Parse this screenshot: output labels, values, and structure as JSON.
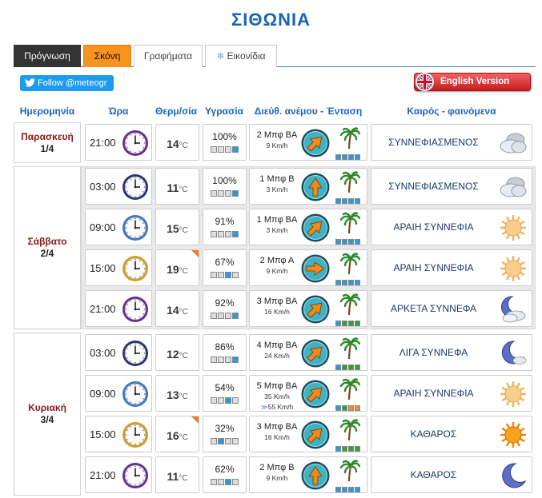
{
  "title": "ΣΙΘΩΝΙΑ",
  "tabs": [
    {
      "label": "Πρόγνωση"
    },
    {
      "label": "Σκόνη"
    },
    {
      "label": "Γραφήματα"
    },
    {
      "label": "Εικονίδια"
    }
  ],
  "twitter": {
    "label": "Follow @meteogr"
  },
  "english": {
    "label": "English Version"
  },
  "headers": {
    "date": "Ημερομηνία",
    "time": "Ώρα",
    "temp": "Θερμ/σία",
    "hum": "Υγρασία",
    "wind": "Διεύθ. ανέμου - Ένταση",
    "weather": "Καιρός - φαινόμενα"
  },
  "temp_unit": "°C",
  "wind_unit": "Km/h",
  "days": [
    {
      "name": "Παρασκευή",
      "date": "1/4"
    },
    {
      "name": "Σάββατο",
      "date": "2/4"
    },
    {
      "name": "Κυριακή",
      "date": "3/4"
    }
  ],
  "rows": [
    {
      "time": "21:00",
      "clock": "purple",
      "temp": "14",
      "hum": "100%",
      "hbars": [
        0,
        0,
        0,
        1
      ],
      "wind": "2 Μπφ ΒΑ",
      "speed": "9",
      "dir": 225,
      "wbars": "bbbb",
      "weather": "ΣΥΝΝΕΦΙΑΣΜΕΝΟΣ",
      "icon": "cloudy"
    },
    {
      "time": "03:00",
      "clock": "navy",
      "temp": "11",
      "hum": "100%",
      "hbars": [
        0,
        0,
        0,
        1
      ],
      "wind": "1 Μπφ Β",
      "speed": "3",
      "dir": 180,
      "wbars": "bbbb",
      "weather": "ΣΥΝΝΕΦΙΑΣΜΕΝΟΣ",
      "icon": "cloudy"
    },
    {
      "time": "09:00",
      "clock": "blue",
      "temp": "15",
      "hum": "91%",
      "hbars": [
        0,
        0,
        0,
        1
      ],
      "wind": "1 Μπφ ΒΑ",
      "speed": "3",
      "dir": 225,
      "wbars": "bbbb",
      "weather": "ΑΡΑΙΗ ΣΥΝΝΕΦΙΑ",
      "icon": "sunpale"
    },
    {
      "time": "15:00",
      "clock": "gold",
      "temp": "19",
      "tri": true,
      "hum": "67%",
      "hbars": [
        0,
        0,
        1,
        0
      ],
      "wind": "2 Μπφ Α",
      "speed": "9",
      "dir": 270,
      "wbars": "bbbb",
      "weather": "ΑΡΑΙΗ ΣΥΝΝΕΦΙΑ",
      "icon": "sunpale"
    },
    {
      "time": "21:00",
      "clock": "purple",
      "temp": "14",
      "hum": "92%",
      "hbars": [
        0,
        0,
        0,
        1
      ],
      "wind": "3 Μπφ ΒΑ",
      "speed": "16",
      "dir": 225,
      "wbars": "bggg",
      "weather": "ΑΡΚΕΤΑ ΣΥΝΝΕΦΑ",
      "icon": "mooncloud"
    },
    {
      "time": "03:00",
      "clock": "navy",
      "temp": "12",
      "hum": "86%",
      "hbars": [
        0,
        0,
        0,
        1
      ],
      "wind": "4 Μπφ ΒΑ",
      "speed": "24",
      "dir": 225,
      "wbars": "bggg",
      "weather": "ΛΙΓΑ ΣΥΝΝΕΦΑ",
      "icon": "moonsmall"
    },
    {
      "time": "09:00",
      "clock": "blue",
      "temp": "13",
      "hum": "54%",
      "hbars": [
        0,
        0,
        1,
        0
      ],
      "wind": "5 Μπφ ΒΑ",
      "speed": "35",
      "gust": "55",
      "dir": 225,
      "wbars": "bgoo",
      "weather": "ΑΡΑΙΗ ΣΥΝΝΕΦΙΑ",
      "icon": "sunpale"
    },
    {
      "time": "15:00",
      "clock": "gold",
      "temp": "16",
      "tri": true,
      "hum": "32%",
      "hbars": [
        0,
        1,
        0,
        0
      ],
      "wind": "3 Μπφ ΒΑ",
      "speed": "16",
      "dir": 225,
      "wbars": "bggg",
      "weather": "ΚΑΘΑΡΟΣ",
      "icon": "sun"
    },
    {
      "time": "21:00",
      "clock": "purple",
      "temp": "11",
      "hum": "62%",
      "hbars": [
        0,
        0,
        1,
        0
      ],
      "wind": "2 Μπφ Β",
      "speed": "9",
      "dir": 180,
      "wbars": "bbbb",
      "weather": "ΚΑΘΑΡΟΣ",
      "icon": "moon"
    }
  ]
}
